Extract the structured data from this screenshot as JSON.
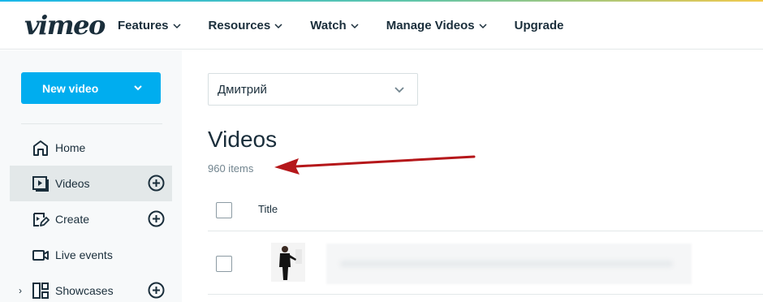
{
  "header": {
    "logo": "vimeo",
    "nav": [
      {
        "label": "Features",
        "has_dropdown": true
      },
      {
        "label": "Resources",
        "has_dropdown": true
      },
      {
        "label": "Watch",
        "has_dropdown": true
      },
      {
        "label": "Manage Videos",
        "has_dropdown": true
      },
      {
        "label": "Upgrade",
        "has_dropdown": false
      }
    ]
  },
  "sidebar": {
    "new_video_label": "New video",
    "items": [
      {
        "label": "Home",
        "icon": "home-icon"
      },
      {
        "label": "Videos",
        "icon": "videos-icon",
        "active": true,
        "has_add": true
      },
      {
        "label": "Create",
        "icon": "create-icon",
        "has_add": true
      },
      {
        "label": "Live events",
        "icon": "live-events-icon"
      },
      {
        "label": "Showcases",
        "icon": "showcases-icon",
        "has_add": true,
        "expandable": true
      }
    ]
  },
  "main": {
    "team_select": "Дмитрий",
    "title": "Videos",
    "count": "960 items",
    "table": {
      "columns": [
        "Title"
      ],
      "rows": [
        {
          "title": ""
        }
      ]
    }
  },
  "colors": {
    "accent": "#00adef",
    "text": "#1a2e3b",
    "muted": "#72858f",
    "annotation_arrow": "#b5171a"
  }
}
